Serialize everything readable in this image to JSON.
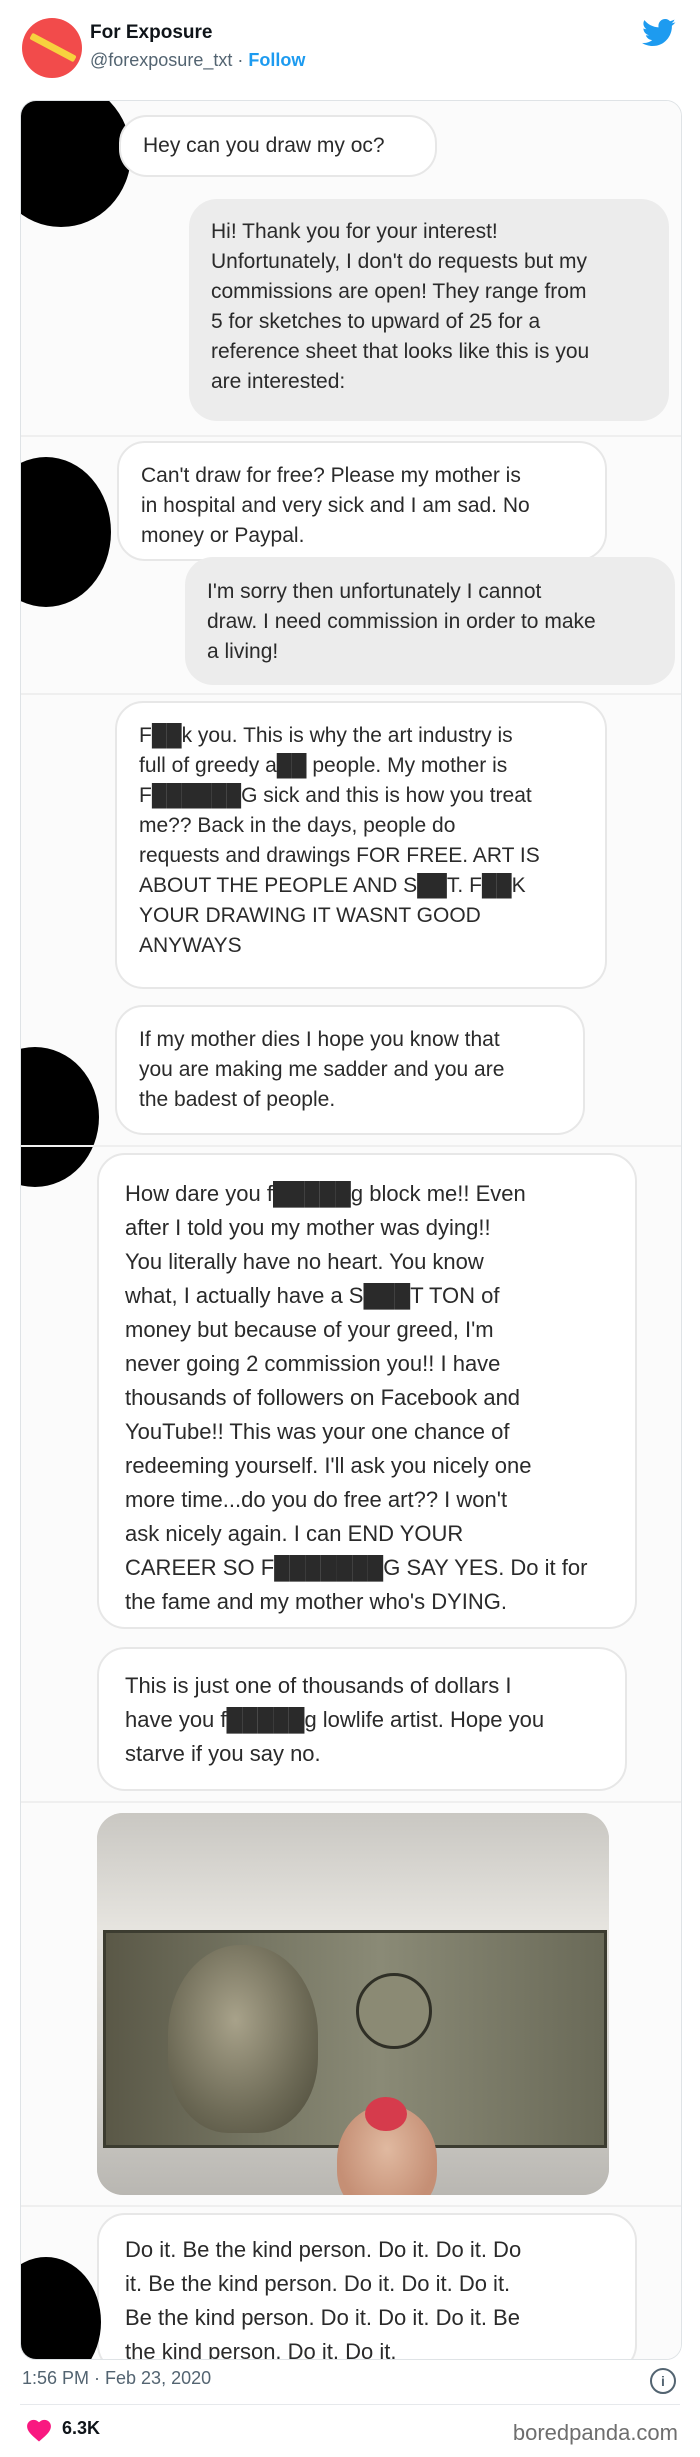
{
  "tweet": {
    "display_name": "For Exposure",
    "handle": "@forexposure_txt",
    "separator": "·",
    "follow_label": "Follow",
    "timestamp": "1:56 PM · Feb 23, 2020",
    "like_count": "6.3K",
    "watermark": "boredpanda.com"
  },
  "colors": {
    "accent": "#1d9bf0",
    "avatar": "#f24b4b",
    "like": "#f91880"
  },
  "icons": [
    "twitter-bird-icon",
    "info-icon",
    "heart-icon"
  ],
  "messages": [
    {
      "from": "them",
      "text": "Hey can you draw my oc?"
    },
    {
      "from": "me",
      "text": "Hi! Thank you for your interest!\nUnfortunately, I don't do requests but my\ncommissions are open! They range from\n5 for sketches to upward of 25 for a\nreference sheet that looks like this is you\nare interested:"
    },
    {
      "from": "them",
      "text": "Can't draw for free? Please my mother is\nin hospital and very sick and I am sad. No\nmoney or Paypal."
    },
    {
      "from": "me",
      "text": "I'm sorry then unfortunately I cannot\ndraw. I need commission in order to make\na living!"
    },
    {
      "from": "them",
      "text": "F██k you. This is why the art industry is\nfull of greedy a██ people. My mother is\nF██████G sick and this is how you treat\nme?? Back in the days, people do\nrequests and drawings FOR FREE. ART IS\nABOUT THE PEOPLE AND S██T. F██K\nYOUR DRAWING IT WASNT GOOD\nANYWAYS"
    },
    {
      "from": "them",
      "text": "If my mother dies I hope you know that\nyou are making me sadder and you are\nthe badest of people."
    },
    {
      "from": "them",
      "text": "How dare you f█████g block me!! Even\nafter I told you my mother was dying!!\nYou literally have no heart. You know\nwhat, I actually have a S███T TON of\nmoney but because of your greed, I'm\nnever going 2 commission you!! I have\nthousands of followers on Facebook and\nYouTube!! This was your one chance of\nredeeming yourself. I'll ask you nicely one\nmore time...do you do free art?? I won't\nask nicely again. I can END YOUR\nCAREER SO F███████G SAY YES. Do it for\nthe fame and my mother who's DYING."
    },
    {
      "from": "them",
      "text": "This is just one of thousands of dollars I\nhave you f█████g lowlife artist. Hope you\nstarve if you say no."
    },
    {
      "from": "them",
      "text": "Do it. Be the kind person. Do it. Do it. Do\nit. Be the kind person. Do it. Do it. Do it.\nBe the kind person. Do it. Do it. Do it. Be\nthe kind person. Do it. Do it."
    }
  ]
}
